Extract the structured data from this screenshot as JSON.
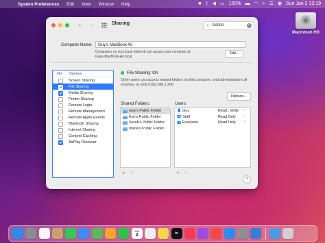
{
  "menubar": {
    "app_name": "System Preferences",
    "items": [
      "Edit",
      "View",
      "Window",
      "Help"
    ],
    "clock": "Sun Jan 2  13:19",
    "battery_percent": "100%"
  },
  "desktop": {
    "disk_label": "Macintosh HD"
  },
  "window": {
    "title": "Sharing",
    "search_value": "button",
    "computer_name_label": "Computer Name:",
    "computer_name_value": "Guy's MacBook Air",
    "computer_name_note": "Computers on your local network can access your computer at:",
    "computer_name_address": "Guys-MacBook-Air.local",
    "edit_button": "Edit...",
    "service_list": {
      "header_on": "On",
      "header_service": "Service",
      "items": [
        {
          "label": "Screen Sharing",
          "checked": false,
          "selected": false
        },
        {
          "label": "File Sharing",
          "checked": true,
          "selected": true
        },
        {
          "label": "Media Sharing",
          "checked": true,
          "selected": false
        },
        {
          "label": "Printer Sharing",
          "checked": false,
          "selected": false
        },
        {
          "label": "Remote Login",
          "checked": false,
          "selected": false
        },
        {
          "label": "Remote Management",
          "checked": false,
          "selected": false
        },
        {
          "label": "Remote Apple Events",
          "checked": false,
          "selected": false
        },
        {
          "label": "Bluetooth Sharing",
          "checked": false,
          "selected": false
        },
        {
          "label": "Internet Sharing",
          "checked": false,
          "selected": false
        },
        {
          "label": "Content Caching",
          "checked": false,
          "selected": false
        },
        {
          "label": "AirPlay Receiver",
          "checked": true,
          "selected": false
        }
      ]
    },
    "status_text": "File Sharing: On",
    "description": "Other users can access shared folders on this computer, and administrators all volumes, at smb://192.168.1.209",
    "options_button": "Options...",
    "shared_folders_label": "Shared Folders:",
    "shared_folders": [
      {
        "name": "Guy's Public Folder",
        "selected": true
      },
      {
        "name": "Kay's Public Folder",
        "selected": false
      },
      {
        "name": "Sarah's Public Folder",
        "selected": false
      },
      {
        "name": "maria's Public Folder",
        "selected": false
      }
    ],
    "users_label": "Users:",
    "users": [
      {
        "name": "Guy",
        "permission": "Read...Write",
        "icon": "single-user-icon"
      },
      {
        "name": "Staff",
        "permission": "Read Only",
        "icon": "group-icon"
      },
      {
        "name": "Everyone",
        "permission": "Read Only",
        "icon": "group-icon"
      }
    ],
    "add_symbol": "+",
    "remove_symbol": "−",
    "help_symbol": "?"
  },
  "dock": {
    "icons": [
      {
        "name": "finder-icon",
        "color": "#2d8cf0"
      },
      {
        "name": "launchpad-icon",
        "color": "#8a8a8f"
      },
      {
        "name": "beeper-icon",
        "color": "#f5f5f5"
      },
      {
        "name": "contacts-icon",
        "color": "#caa26a"
      },
      {
        "name": "messages-icon",
        "color": "#34c759"
      },
      {
        "name": "mail-icon",
        "color": "#3b8df5"
      },
      {
        "name": "maps-icon",
        "color": "#5cb85c"
      },
      {
        "name": "photos-icon",
        "color": "#f4a52b"
      },
      {
        "name": "facetime-icon",
        "color": "#2fbf4a"
      },
      {
        "name": "calendar-icon",
        "color": "#ffffff"
      },
      {
        "name": "reminders-icon",
        "color": "#eeeeee"
      },
      {
        "name": "notes-icon",
        "color": "#f7d54a"
      },
      {
        "name": "tv-icon",
        "color": "#111111"
      },
      {
        "name": "music-icon",
        "color": "#fa3a55"
      },
      {
        "name": "podcasts-icon",
        "color": "#a149e0"
      },
      {
        "name": "news-icon",
        "color": "#f24a4a"
      },
      {
        "name": "appstore-icon",
        "color": "#2d8cf0"
      },
      {
        "name": "system-preferences-icon",
        "color": "#8e8e93"
      },
      {
        "name": "xcode-icon",
        "color": "#3a7bd5"
      },
      {
        "name": "folder-icon",
        "color": "#4a9ae8"
      },
      {
        "name": "trash-icon",
        "color": "#cfcfd4"
      }
    ],
    "calendar_day": "2",
    "calendar_month": "JAN",
    "tv_label": "tv"
  }
}
